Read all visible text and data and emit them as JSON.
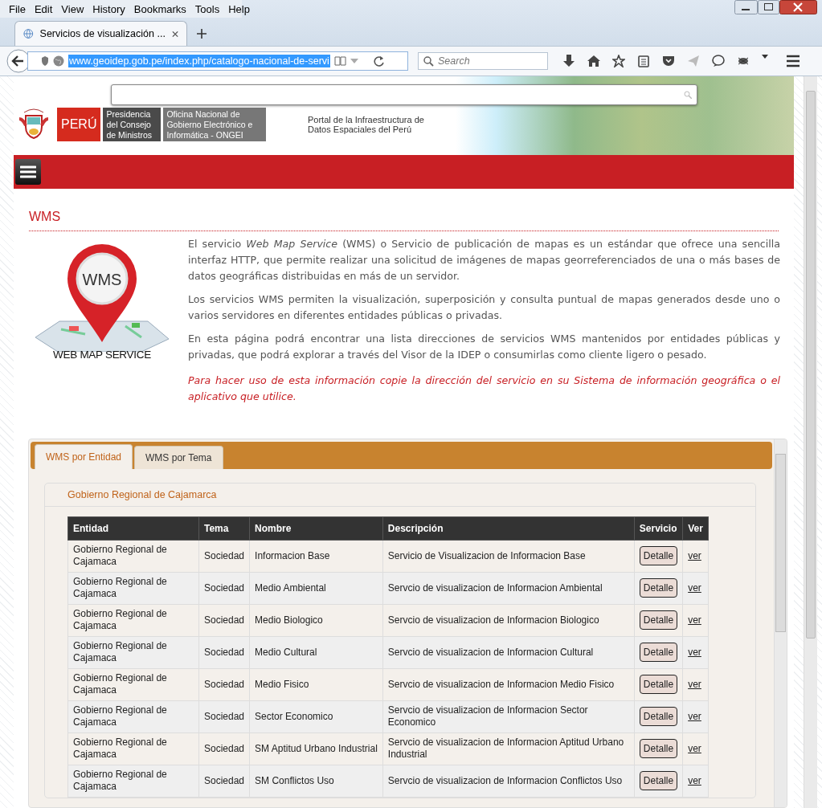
{
  "browser": {
    "menu": [
      "File",
      "Edit",
      "View",
      "History",
      "Bookmarks",
      "Tools",
      "Help"
    ],
    "tab_title": "Servicios de visualización ...",
    "url": "www.geoidep.gob.pe/index.php/catalogo-nacional-de-servi",
    "search": {
      "placeholder": "Search"
    }
  },
  "header": {
    "peru": "PERÚ",
    "pcm": "Presidencia del Consejo de Ministros",
    "ongei": "Oficina Nacional de Gobierno Electrónico e Informática - ONGEI",
    "portal": "Portal de la Infraestructura de Datos Espaciales del Perú"
  },
  "page": {
    "title": "WMS",
    "logo_pin": "WMS",
    "logo_caption": "WEB MAP SERVICE",
    "paragraphs": [
      "El servicio *Web Map Service* (WMS) o Servicio de publicación de mapas es un estándar que ofrece una sencilla interfaz HTTP, que permite realizar una solicitud de imágenes de mapas georreferenciados de una o más bases de datos geográficas distribuidas en más de un servidor.",
      "Los servicios WMS permiten la visualización, superposición y consulta puntual de mapas generados desde uno o varios servidores en diferentes entidades públicas o privadas.",
      "En esta página podrá encontrar una lista direcciones de servicios WMS mantenidos por entidades públicas y privadas, que podrá explorar a través del Visor de la IDEP o consumirlas como cliente ligero o pesado."
    ],
    "notice": "Para hacer uso de esta información copie la dirección del servicio en su Sistema de información geográfica o el aplicativo que utilice."
  },
  "tabs": [
    {
      "label": "WMS por Entidad",
      "selected": true
    },
    {
      "label": "WMS por Tema",
      "selected": false
    }
  ],
  "group": "Gobierno Regional de Cajamarca",
  "table": {
    "columns": [
      "Entidad",
      "Tema",
      "Nombre",
      "Descripción",
      "Servicio",
      "Ver"
    ],
    "rows": [
      {
        "entidad": "Gobierno Regional de Cajamaca",
        "tema": "Sociedad",
        "nombre": "Informacion Base",
        "descripcion": "Servicio de Visualizacion de Informacion Base",
        "servicio": "Detalle",
        "ver": "ver"
      },
      {
        "entidad": "Gobierno Regional de Cajamaca",
        "tema": "Sociedad",
        "nombre": "Medio Ambiental",
        "descripcion": "Servcio de visualizacion de Informacion Ambiental",
        "servicio": "Detalle",
        "ver": "ver"
      },
      {
        "entidad": "Gobierno Regional de Cajamaca",
        "tema": "Sociedad",
        "nombre": "Medio Biologico",
        "descripcion": "Servcio de visualizacion de Informacion Biologico",
        "servicio": "Detalle",
        "ver": "ver"
      },
      {
        "entidad": "Gobierno Regional de Cajamaca",
        "tema": "Sociedad",
        "nombre": "Medio Cultural",
        "descripcion": "Servcio de visualizacion de Informacion Cultural",
        "servicio": "Detalle",
        "ver": "ver"
      },
      {
        "entidad": "Gobierno Regional de Cajamaca",
        "tema": "Sociedad",
        "nombre": "Medio Fisico",
        "descripcion": "Servcio de visualizacion de Informacion Medio Fisico",
        "servicio": "Detalle",
        "ver": "ver"
      },
      {
        "entidad": "Gobierno Regional de Cajamaca",
        "tema": "Sociedad",
        "nombre": "Sector Economico",
        "descripcion": "Servcio de visualizacion de Informacion Sector Economico",
        "servicio": "Detalle",
        "ver": "ver"
      },
      {
        "entidad": "Gobierno Regional de Cajamaca",
        "tema": "Sociedad",
        "nombre": "SM Aptitud Urbano Industrial",
        "descripcion": "Servcio de visualizacion de Informacion Aptitud Urbano Industrial",
        "servicio": "Detalle",
        "ver": "ver"
      },
      {
        "entidad": "Gobierno Regional de Cajamaca",
        "tema": "Sociedad",
        "nombre": "SM Conflictos Uso",
        "descripcion": "Servcio de visualizacion de Informacion Conflictos Uso",
        "servicio": "Detalle",
        "ver": "ver"
      }
    ]
  }
}
